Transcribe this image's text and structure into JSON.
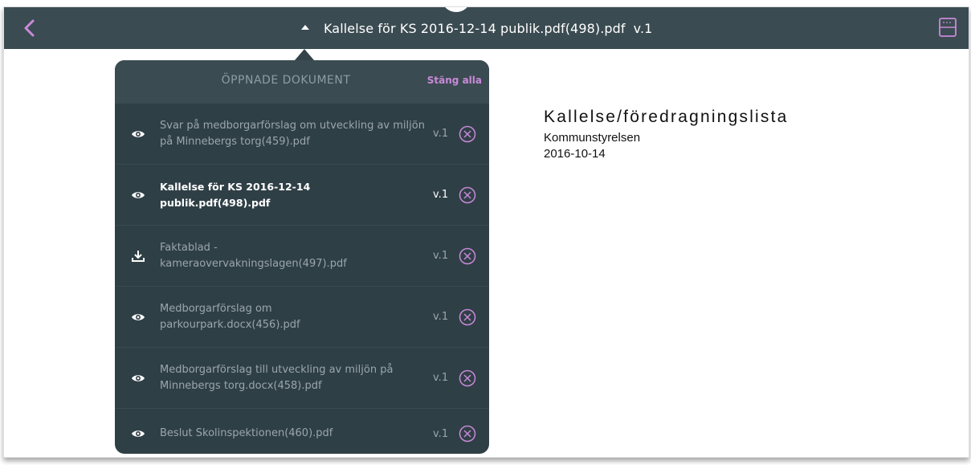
{
  "header": {
    "title": "Kallelse för KS 2016-12-14 publik.pdf(498).pdf",
    "version": "v.1",
    "icons": {
      "back": "chevron-left-icon",
      "right": "page-layout-icon",
      "toggle": "caret-up-icon"
    }
  },
  "panel": {
    "title": "ÖPPNADE DOKUMENT",
    "close_all": "Stäng alla",
    "items": [
      {
        "name": "Svar på medborgarförslag om utveckling av miljön på Minnebergs torg(459).pdf",
        "version": "v.1",
        "icon": "eye-icon",
        "active": false
      },
      {
        "name": "Kallelse för KS 2016-12-14 publik.pdf(498).pdf",
        "version": "v.1",
        "icon": "eye-icon",
        "active": true
      },
      {
        "name": "Faktablad - kameraovervakningslagen(497).pdf",
        "version": "v.1",
        "icon": "download-icon",
        "active": false
      },
      {
        "name": "Medborgarförslag om parkourpark.docx(456).pdf",
        "version": "v.1",
        "icon": "eye-icon",
        "active": false
      },
      {
        "name": "Medborgarförslag till utveckling av miljön på Minnebergs torg.docx(458).pdf",
        "version": "v.1",
        "icon": "eye-icon",
        "active": false
      },
      {
        "name": "Beslut Skolinspektionen(460).pdf",
        "version": "v.1",
        "icon": "eye-icon",
        "active": false
      }
    ]
  },
  "document": {
    "title": "Kallelse/föredragningslista",
    "organization": "Kommunstyrelsen",
    "date": "2016-10-14"
  },
  "colors": {
    "topbar": "#3b4b52",
    "panel": "#2f3f46",
    "accent": "#c88ad8"
  }
}
